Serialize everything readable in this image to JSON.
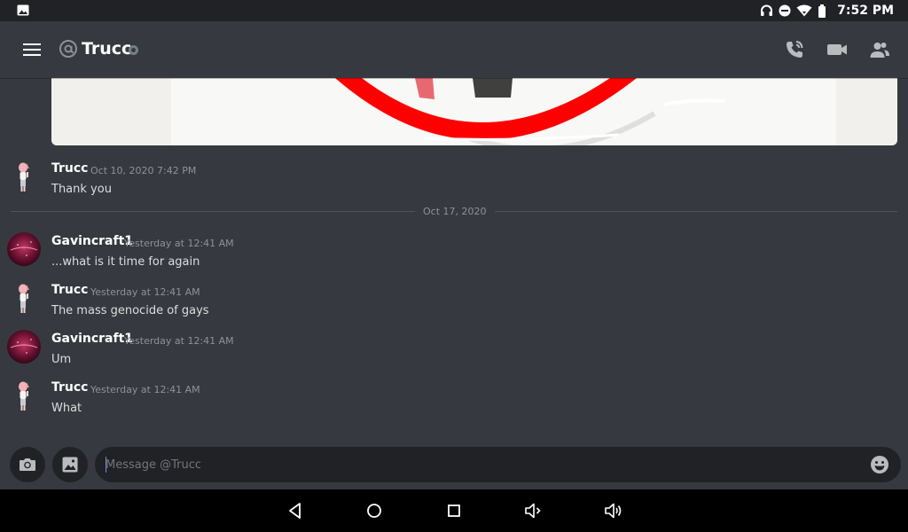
{
  "status_bar": {
    "time": "7:52 PM",
    "icons": [
      "image-icon",
      "headphones-icon",
      "do-not-disturb-icon",
      "wifi-icon",
      "battery-icon"
    ]
  },
  "header": {
    "channel_name": "Trucc",
    "icons": [
      "menu-icon",
      "at-icon",
      "presence-dot",
      "call-icon",
      "video-icon",
      "members-icon"
    ]
  },
  "messages": [
    {
      "author": "Trucc",
      "time": "Oct 10, 2020 7:42 PM",
      "text": "Thank you",
      "avatar": "anime-avatar"
    },
    {
      "author": "Gavincraft1",
      "time": "Yesterday at 12:41 AM",
      "text": "...what is it time for again",
      "avatar": "galaxy-avatar"
    },
    {
      "author": "Trucc",
      "time": "Yesterday at 12:41 AM",
      "text": "The mass genocide of gays",
      "avatar": "anime-avatar"
    },
    {
      "author": "Gavincraft1",
      "time": "Yesterday at 12:41 AM",
      "text": "Um",
      "avatar": "galaxy-avatar"
    },
    {
      "author": "Trucc",
      "time": "Yesterday at 12:41 AM",
      "text": "What",
      "avatar": "anime-avatar"
    }
  ],
  "date_divider": "Oct 17, 2020",
  "composer": {
    "placeholder": "Message @Trucc",
    "icons": [
      "camera-icon",
      "gallery-icon",
      "emoji-icon"
    ]
  },
  "navbar": {
    "icons": [
      "back-icon",
      "home-icon",
      "recents-icon",
      "volume-down-icon",
      "volume-up-icon"
    ]
  },
  "colors": {
    "background": "#36393f",
    "input": "#202225",
    "accent": "#7289da",
    "muted": "#8e9297",
    "embed_red": "#ff0000"
  }
}
